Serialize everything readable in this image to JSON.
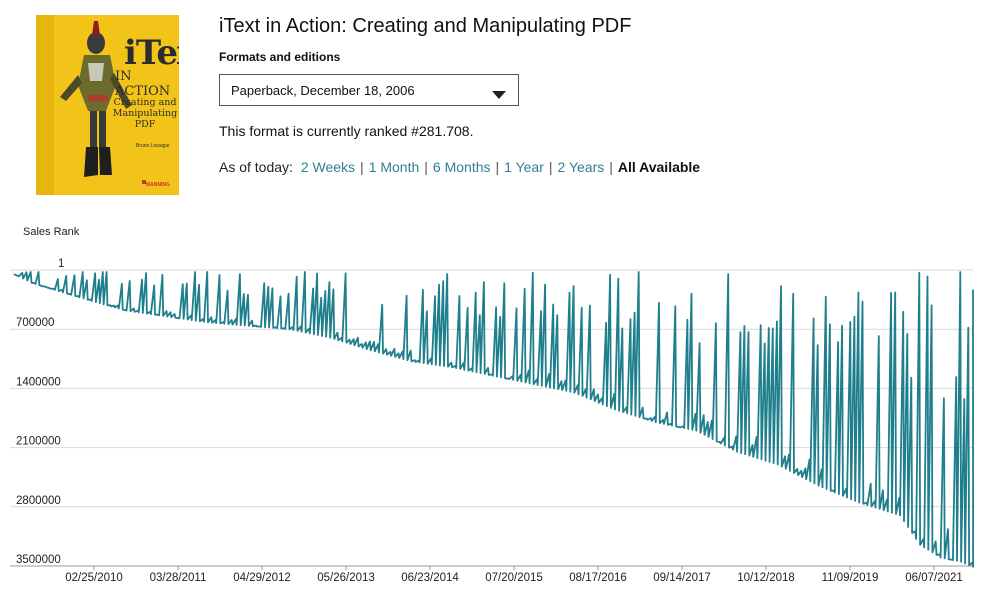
{
  "book": {
    "title": "iText in Action: Creating and Manipulating PDF",
    "cover": {
      "title_line": "iText",
      "subtitle_line": "IN ACTION",
      "tagline": "Creating and Manipulating PDF",
      "author": "Bruno Lowagie",
      "publisher_mark": "MANNING",
      "bg_color": "#f2c419"
    }
  },
  "formats": {
    "label": "Formats and editions",
    "selected": "Paperback, December 18, 2006",
    "dropdown_icon": "caret-down-icon"
  },
  "rank_text": "This format is currently ranked #281.708.",
  "range": {
    "prefix": "As of today:",
    "options": [
      "2 Weeks",
      "1 Month",
      "6 Months",
      "1 Year",
      "2 Years",
      "All Available"
    ],
    "selected": "All Available",
    "link_color": "#2d8193"
  },
  "chart_data": {
    "type": "line",
    "ylabel": "Sales Rank",
    "y_reversed": true,
    "ylim": [
      1,
      3500000
    ],
    "yticks": [
      1,
      700000,
      1400000,
      2100000,
      2800000,
      3500000
    ],
    "ytick_labels": [
      "1",
      "700000",
      "1400000",
      "2100000",
      "2800000",
      "3500000"
    ],
    "xtick_labels": [
      "02/25/2010",
      "03/28/2011",
      "04/29/2012",
      "05/26/2013",
      "06/23/2014",
      "07/20/2015",
      "08/17/2016",
      "09/14/2017",
      "10/12/2018",
      "11/09/2019",
      "06/07/2021"
    ],
    "grid": true,
    "line_color": "#1f7f8c",
    "series": [
      {
        "points": [
          [
            "2010-01-15",
            50000
          ],
          [
            "2010-04-01",
            150000
          ],
          [
            "2010-08-01",
            250000
          ],
          [
            "2011-01-15",
            380000
          ],
          [
            "2011-06-01",
            480000
          ],
          [
            "2011-12-01",
            550000
          ],
          [
            "2012-06-01",
            620000
          ],
          [
            "2012-12-01",
            660000
          ],
          [
            "2013-06-01",
            700000
          ],
          [
            "2013-12-01",
            800000
          ],
          [
            "2014-06-01",
            950000
          ],
          [
            "2014-12-01",
            1080000
          ],
          [
            "2015-06-01",
            1150000
          ],
          [
            "2015-12-01",
            1250000
          ],
          [
            "2016-06-01",
            1350000
          ],
          [
            "2016-12-01",
            1450000
          ],
          [
            "2017-06-01",
            1650000
          ],
          [
            "2017-12-01",
            1800000
          ],
          [
            "2018-06-01",
            1900000
          ],
          [
            "2018-12-01",
            2150000
          ],
          [
            "2019-06-01",
            2300000
          ],
          [
            "2019-12-01",
            2550000
          ],
          [
            "2020-06-01",
            2750000
          ],
          [
            "2020-12-01",
            2900000
          ],
          [
            "2021-03-01",
            3250000
          ],
          [
            "2021-06-01",
            3400000
          ],
          [
            "2021-09-01",
            3450000
          ],
          [
            "2021-10-25",
            3510000
          ],
          [
            "2021-10-28",
            230000
          ]
        ]
      }
    ]
  }
}
